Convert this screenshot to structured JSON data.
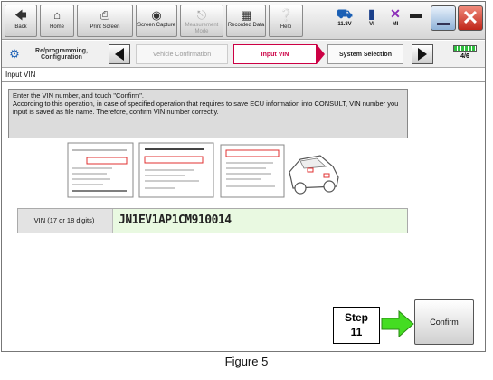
{
  "toolbar": {
    "buttons": [
      {
        "label": "Back",
        "icon": "back-arrow-icon"
      },
      {
        "label": "Home",
        "icon": "home-icon"
      },
      {
        "label": "Print Screen",
        "icon": "printer-icon"
      },
      {
        "label": "Screen Capture",
        "icon": "camera-icon"
      },
      {
        "label": "Measurement Mode",
        "icon": "measurement-icon"
      },
      {
        "label": "Recorded Data",
        "icon": "recorded-data-icon"
      },
      {
        "label": "Help",
        "icon": "help-icon"
      }
    ],
    "status": {
      "battery": "11.8V",
      "vi": "VI",
      "mi": "MI",
      "page_counter": "4/6"
    }
  },
  "navbar": {
    "crumb_reprogramming": "Re/programming, Configuration",
    "crumb_vehicle_confirmation": "Vehicle Confirmation",
    "crumb_input_vin": "Input VIN",
    "crumb_system_selection": "System Selection"
  },
  "page_title": "Input VIN",
  "instructions": {
    "line1": "Enter the VIN number, and touch \"Confirm\".",
    "line2": "According to this operation, in case of specified operation that requires to save ECU information into CONSULT, VIN number you input is saved as file name. Therefore, confirm VIN number correctly."
  },
  "vin_field": {
    "label": "VIN (17 or 18 digits)",
    "value": "JN1EV1AP1CM910014"
  },
  "confirm_label": "Confirm",
  "step_callout": {
    "line1": "Step",
    "line2": "11"
  },
  "figure_caption": "Figure 5",
  "colors": {
    "active_crumb": "#cc0044",
    "vin_field_bg": "#e9f9e1",
    "callout_arrow": "#44dd22"
  }
}
